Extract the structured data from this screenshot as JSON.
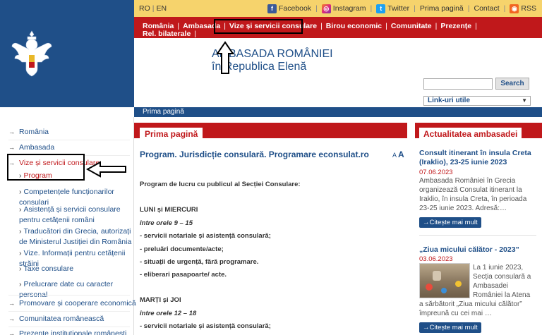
{
  "topbar": {
    "lang_ro": "RO",
    "lang_en": "EN",
    "facebook": "Facebook",
    "instagram": "Instagram",
    "twitter": "Twitter",
    "home": "Prima pagină",
    "contact": "Contact",
    "rss": "RSS"
  },
  "nav": {
    "items": [
      "România",
      "Ambasada",
      "Vize și servicii consulare",
      "Birou economic",
      "Comunitate",
      "Prezențe",
      "Rel. bilaterale",
      "Republica Elenă"
    ]
  },
  "header": {
    "embassy_line1": "AMBASADA ROMÂNIEI",
    "embassy_line2": "în Republica Elenă"
  },
  "search": {
    "button": "Search",
    "links_label": "Link-uri utile"
  },
  "breadcrumb": "Prima pagină",
  "sidebar": {
    "items": [
      {
        "label": "România"
      },
      {
        "label": "Ambasada"
      },
      {
        "label": "Vize și servicii consulare"
      }
    ],
    "subitems": [
      "Program",
      "Competențele funcționarilor consulari",
      "Asistență și servicii consulare pentru cetățenii români",
      "Traducători din Grecia, autorizați de Ministerul Justiției din România",
      "Vize. Informații pentru cetățenii străini",
      "Taxe consulare",
      "Prelucrare date cu caracter personal"
    ],
    "bottom_items": [
      "Promovare și cooperare economică",
      "Comunitatea românească",
      "Prezențe instituționale românești"
    ]
  },
  "main": {
    "tab": "Prima pagină",
    "title": "Program. Jurisdicție consulară. Programare econsulat.ro",
    "font_small": "A",
    "font_large": "A",
    "lines": [
      "Program de lucru cu publicul al Secției Consulare:",
      "LUNI și MIERCURI",
      "între orele 9 – 15",
      "- servicii notariale și asistență consulară;",
      "- preluări documente/acte;",
      "- situații de urgență, fără programare.",
      "- eliberari pasapoarte/ acte.",
      "MARȚI și JOI",
      "între orele 12 – 18",
      "- servicii notariale și asistență consulară;"
    ]
  },
  "news": {
    "tab": "Actualitatea ambasadei",
    "items": [
      {
        "title": "Consult itinerant în insula Creta (Iraklio), 23-25 iunie 2023",
        "date": "07.06.2023",
        "body": "Ambasada României în Grecia organizează Consulat itinerant la Iraklio, în insula Creta, în perioada 23-25 iunie 2023. Adresă:…",
        "more": "→Citește mai mult"
      },
      {
        "title": "„Ziua micului călător - 2023”",
        "date": "03.06.2023",
        "body": "La 1 iunie 2023, Secția consulară a Ambasadei României la Atena a sărbătorit „Ziua micului călător” împreună cu cei mai …",
        "more": "→Citește mai mult"
      }
    ]
  },
  "colors": {
    "brand_blue": "#1f4f88",
    "brand_red": "#c0181b",
    "top_yellow": "#f6d36c"
  }
}
